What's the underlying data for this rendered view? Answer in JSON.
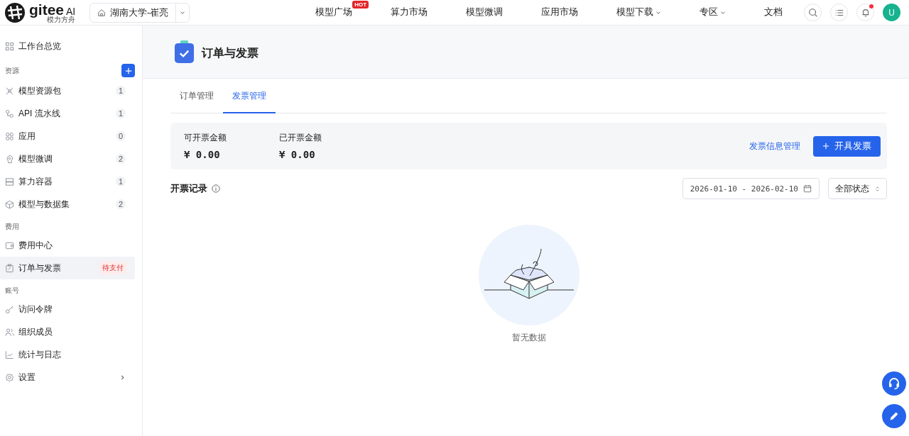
{
  "header": {
    "logo": {
      "name": "gitee",
      "suffix": "AI",
      "subtitle": "模力方舟"
    },
    "org_selector": {
      "label": "湖南大学-崔亮"
    },
    "nav": [
      {
        "label": "模型广场",
        "badge": "HOT",
        "has_menu": false
      },
      {
        "label": "算力市场",
        "has_menu": false
      },
      {
        "label": "模型微调",
        "has_menu": false
      },
      {
        "label": "应用市场",
        "has_menu": false
      },
      {
        "label": "模型下载",
        "has_menu": true
      },
      {
        "label": "专区",
        "has_menu": true
      },
      {
        "label": "文档",
        "has_menu": false
      }
    ],
    "notifications_unread": true,
    "avatar": "U"
  },
  "sidebar": {
    "sections": [
      {
        "items": [
          {
            "label": "工作台总览",
            "selected": false
          }
        ]
      },
      {
        "title": "资源",
        "add_button": true,
        "items": [
          {
            "label": "模型资源包",
            "count": "1",
            "selected": false
          },
          {
            "label": "API 流水线",
            "count": "1",
            "selected": false
          },
          {
            "label": "应用",
            "count": "0",
            "selected": false
          },
          {
            "label": "模型微调",
            "count": "2",
            "selected": false
          },
          {
            "label": "算力容器",
            "count": "1",
            "selected": false
          },
          {
            "label": "模型与数据集",
            "count": "2",
            "selected": false
          }
        ]
      },
      {
        "title": "费用",
        "items": [
          {
            "label": "费用中心",
            "selected": false
          },
          {
            "label": "订单与发票",
            "badge": "待支付",
            "selected": true
          }
        ]
      },
      {
        "title": "账号",
        "items": [
          {
            "label": "访问令牌",
            "selected": false
          },
          {
            "label": "组织成员",
            "selected": false
          },
          {
            "label": "统计与日志",
            "selected": false
          },
          {
            "label": "设置",
            "has_arrow": true,
            "selected": false
          }
        ]
      }
    ]
  },
  "page": {
    "title": "订单与发票",
    "tabs": [
      {
        "label": "订单管理",
        "selected": false
      },
      {
        "label": "发票管理",
        "selected": true
      }
    ],
    "summary": [
      {
        "label": "可开票金额",
        "value": "¥ 0.00"
      },
      {
        "label": "已开票金额",
        "value": "¥ 0.00"
      }
    ],
    "info_link": "发票信息管理",
    "issue_button": "开具发票",
    "records": {
      "title": "开票记录",
      "date_range": "2026-01-10 - 2026-02-10",
      "status_filter": "全部状态",
      "empty_text": "暂无数据"
    }
  }
}
